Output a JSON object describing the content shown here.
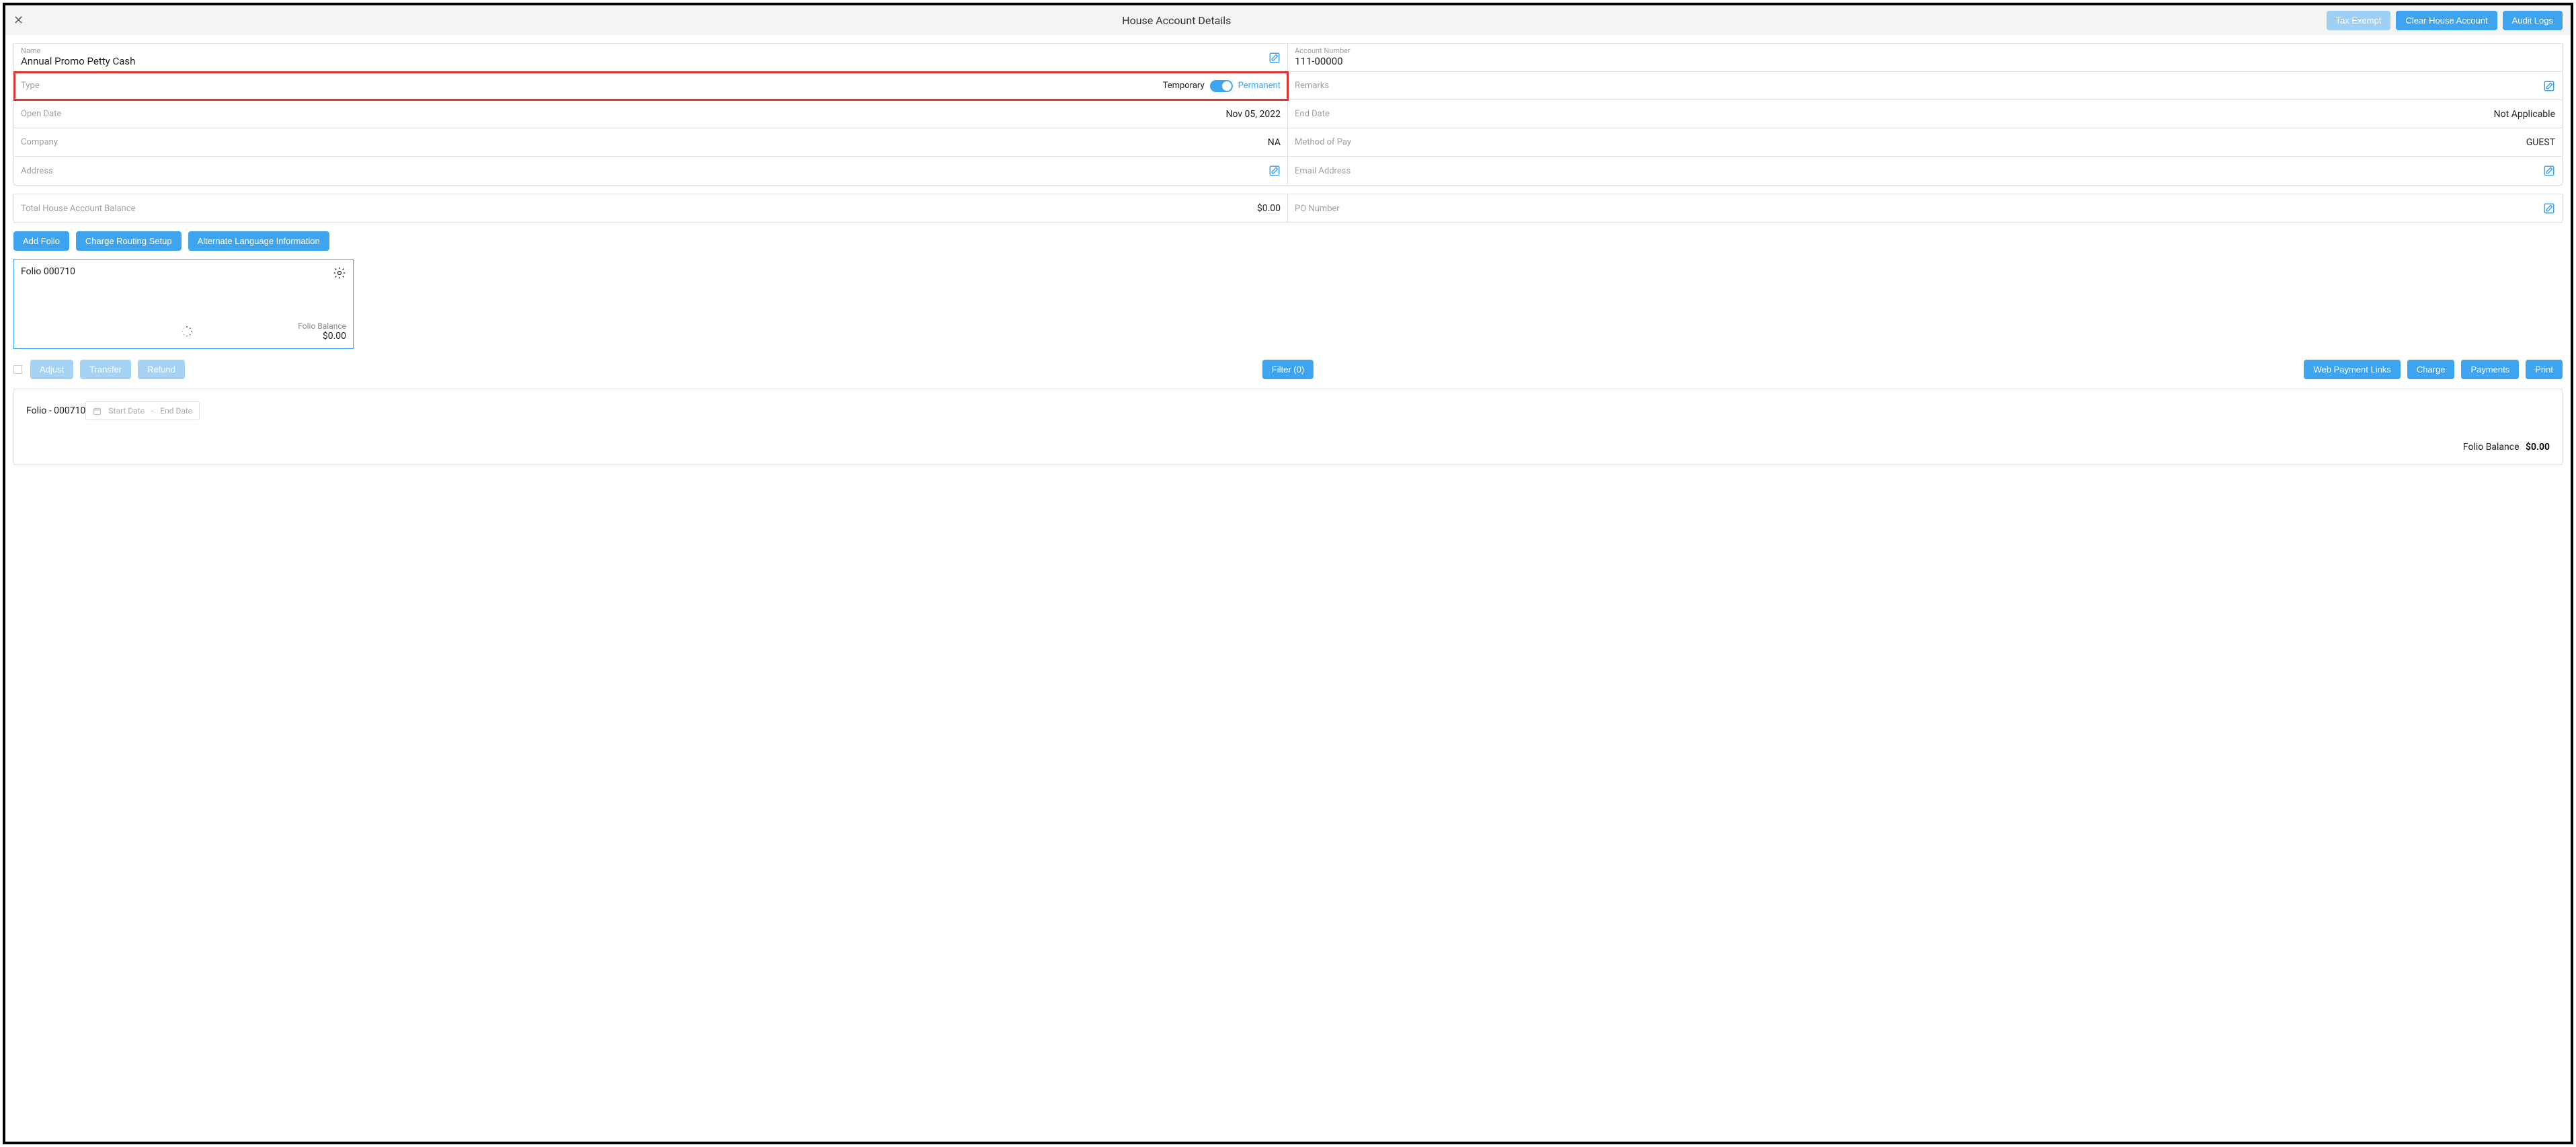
{
  "header": {
    "title": "House Account Details",
    "buttons": {
      "tax_exempt": "Tax Exempt",
      "clear_account": "Clear House Account",
      "audit_logs": "Audit Logs"
    }
  },
  "details": {
    "name": {
      "label": "Name",
      "value": "Annual Promo Petty Cash"
    },
    "account_number": {
      "label": "Account Number",
      "value": "111-00000"
    },
    "type": {
      "label": "Type",
      "temporary_label": "Temporary",
      "permanent_label": "Permanent"
    },
    "remarks": {
      "label": "Remarks"
    },
    "open_date": {
      "label": "Open Date",
      "value": "Nov 05, 2022"
    },
    "end_date": {
      "label": "End Date",
      "value": "Not Applicable"
    },
    "company": {
      "label": "Company",
      "value": "NA"
    },
    "method_of_pay": {
      "label": "Method of Pay",
      "value": "GUEST"
    },
    "address": {
      "label": "Address"
    },
    "email": {
      "label": "Email Address"
    },
    "total_balance": {
      "label": "Total House Account Balance",
      "value": "$0.00"
    },
    "po_number": {
      "label": "PO Number"
    }
  },
  "buttons_row": {
    "add_folio": "Add Folio",
    "charge_routing": "Charge Routing Setup",
    "alt_lang": "Alternate Language Information"
  },
  "folio_card": {
    "title": "Folio 000710",
    "balance_label": "Folio Balance",
    "balance_value": "$0.00"
  },
  "action_bar": {
    "adjust": "Adjust",
    "transfer": "Transfer",
    "refund": "Refund",
    "filter": "Filter (0)",
    "web_payment": "Web Payment Links",
    "charge": "Charge",
    "payments": "Payments",
    "print": "Print"
  },
  "folio_panel": {
    "title": "Folio - 000710",
    "start_date_ph": "Start Date",
    "sep": "-",
    "end_date_ph": "End Date",
    "balance_label": "Folio Balance",
    "balance_value": "$0.00"
  }
}
